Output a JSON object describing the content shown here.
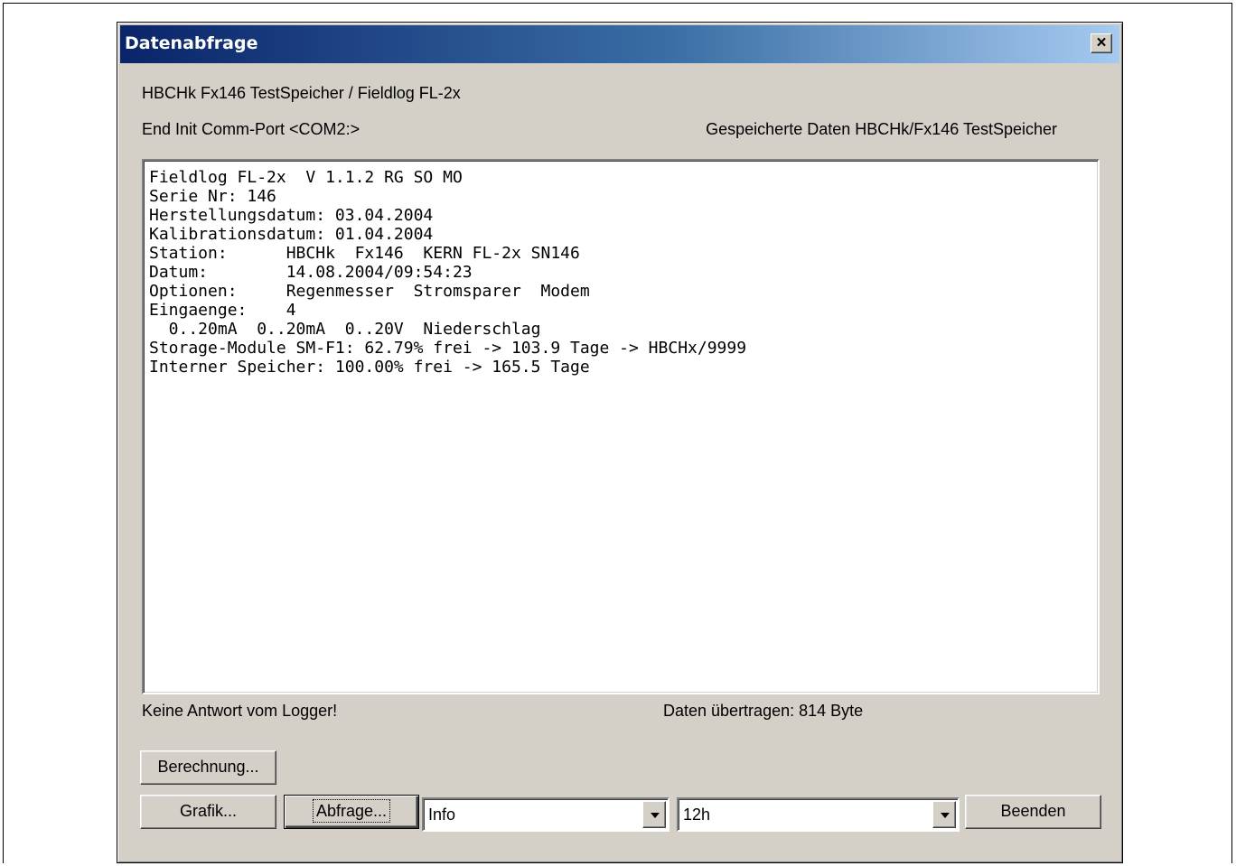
{
  "window": {
    "title": "Datenabfrage",
    "close_label": "×"
  },
  "header": {
    "station_line": "HBCHk  Fx146  TestSpeicher / Fieldlog FL-2x",
    "port_status": "End Init Comm-Port <COM2:>",
    "saved_data": "Gespeicherte Daten HBCHk/Fx146 TestSpeicher"
  },
  "output": {
    "lines": [
      "Fieldlog FL-2x  V 1.1.2 RG SO MO",
      "Serie Nr: 146",
      "Herstellungsdatum: 03.04.2004",
      "Kalibrationsdatum: 01.04.2004",
      "Station:      HBCHk  Fx146  KERN FL-2x SN146",
      "Datum:        14.08.2004/09:54:23",
      "Optionen:     Regenmesser  Stromsparer  Modem",
      "Eingaenge:    4",
      "  0..20mA  0..20mA  0..20V  Niederschlag",
      "Storage-Module SM-F1: 62.79% frei -> 103.9 Tage -> HBCHx/9999",
      "Interner Speicher: 100.00% frei -> 165.5 Tage"
    ]
  },
  "status": {
    "logger_message": "Keine Antwort vom Logger!",
    "transferred": "Daten übertragen: 814 Byte"
  },
  "buttons": {
    "berechnung": "Berechnung...",
    "grafik": "Grafik...",
    "abfrage": "Abfrage...",
    "beenden": "Beenden"
  },
  "combos": {
    "mode": "Info",
    "interval": "12h"
  }
}
